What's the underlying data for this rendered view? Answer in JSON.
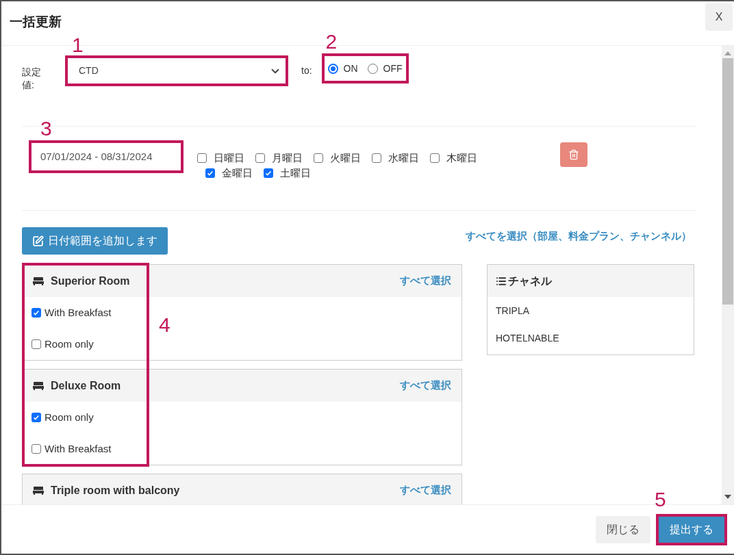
{
  "dialog": {
    "title": "一括更新",
    "close_label": "X"
  },
  "setting": {
    "label": "設定値:",
    "value": "CTD",
    "to_label": "to:",
    "options": [
      {
        "label": "ON",
        "selected": true
      },
      {
        "label": "OFF",
        "selected": false
      }
    ]
  },
  "date_ranges": [
    {
      "range": "07/01/2024 - 08/31/2024",
      "weekdays": [
        {
          "label": "日曜日",
          "checked": false
        },
        {
          "label": "月曜日",
          "checked": false
        },
        {
          "label": "火曜日",
          "checked": false
        },
        {
          "label": "水曜日",
          "checked": false
        },
        {
          "label": "木曜日",
          "checked": false
        },
        {
          "label": "金曜日",
          "checked": true
        },
        {
          "label": "土曜日",
          "checked": true
        }
      ]
    }
  ],
  "add_date_range_label": "日付範囲を追加します",
  "select_all_label": "すべてを選択（部屋、料金プラン、チャンネル）",
  "rooms": [
    {
      "name": "Superior Room",
      "select_all": "すべて選択",
      "plans": [
        {
          "label": "With Breakfast",
          "checked": true
        },
        {
          "label": "Room only",
          "checked": false
        }
      ]
    },
    {
      "name": "Deluxe Room",
      "select_all": "すべて選択",
      "plans": [
        {
          "label": "Room only",
          "checked": true
        },
        {
          "label": "With Breakfast",
          "checked": false
        }
      ]
    },
    {
      "name": "Triple room with balcony",
      "select_all": "すべて選択"
    }
  ],
  "channels": {
    "title": "チャネル",
    "items": [
      "TRIPLA",
      "HOTELNABLE"
    ]
  },
  "footer": {
    "buttons": [
      {
        "label": "閉じる",
        "kind": "secondary"
      },
      {
        "label": "提出する",
        "kind": "primary"
      }
    ]
  },
  "annotations": [
    {
      "label": "1"
    },
    {
      "label": "2"
    },
    {
      "label": "3"
    },
    {
      "label": "4"
    },
    {
      "label": "5"
    }
  ]
}
